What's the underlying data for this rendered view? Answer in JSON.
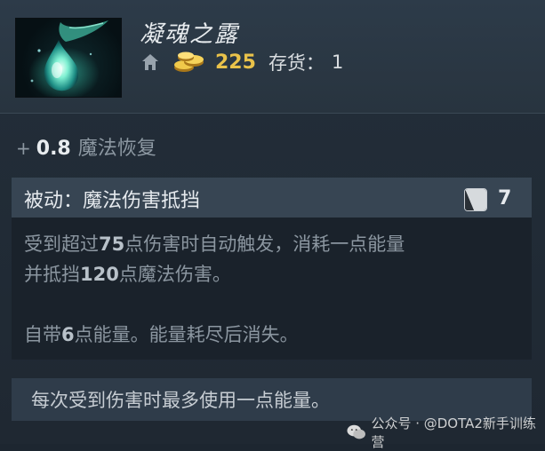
{
  "item": {
    "name": "凝魂之露",
    "price": "225",
    "stock_label": "存货：",
    "stock_value": "1",
    "icon": "infused-raindrop-icon"
  },
  "attribute": {
    "plus": "+",
    "value": "0.8",
    "name": "魔法恢复"
  },
  "ability": {
    "title": "被动：魔法伤害抵挡",
    "cooldown": "7",
    "desc": {
      "line1_a": "受到超过",
      "line1_b": "75",
      "line1_c": "点伤害时自动触发，消耗一点能量",
      "line2_a": "并抵挡",
      "line2_b": "120",
      "line2_c": "点魔法伤害。",
      "line3_a": "自带",
      "line3_b": "6",
      "line3_c": "点能量。能量耗尽后消失。"
    }
  },
  "note": "每次受到伤害时最多使用一点能量。",
  "watermark": "公众号 · @DOTA2新手训练营",
  "colors": {
    "gold": "#e9c24a",
    "panel": "#1f2832",
    "header": "#2d3b49",
    "ability_header": "#374553",
    "note_bg": "#2f3c4a"
  }
}
